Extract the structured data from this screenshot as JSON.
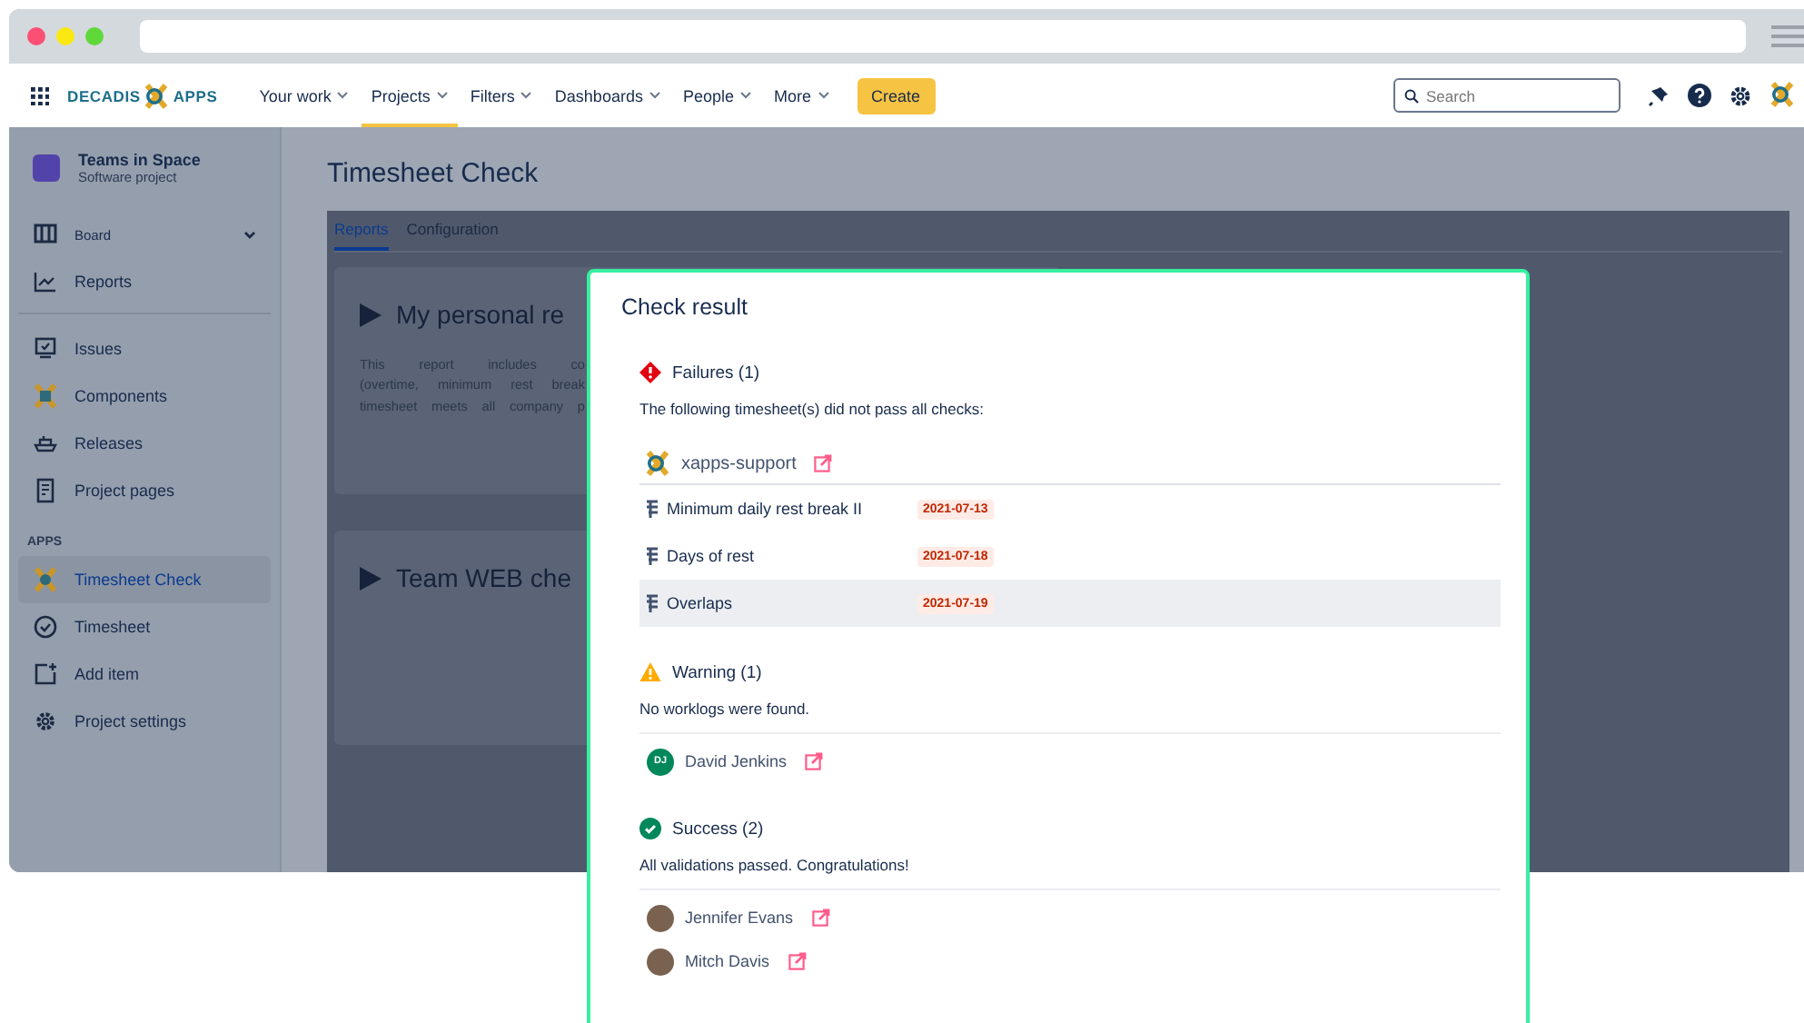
{
  "nav": {
    "logo": {
      "left": "DECADIS",
      "right": "APPS"
    },
    "items": [
      {
        "label": "Your work",
        "selected": false
      },
      {
        "label": "Projects",
        "selected": true
      },
      {
        "label": "Filters",
        "selected": false
      },
      {
        "label": "Dashboards",
        "selected": false
      },
      {
        "label": "People",
        "selected": false
      },
      {
        "label": "More",
        "selected": false
      }
    ],
    "create": "Create",
    "search": {
      "placeholder": "Search"
    }
  },
  "sidebar": {
    "project": {
      "name": "Teams in Space",
      "type": "Software project"
    },
    "groups": [
      {
        "items": [
          {
            "label": "Board",
            "kind": "dropdown",
            "selected": false
          },
          {
            "label": "Reports",
            "kind": "link",
            "selected": false
          }
        ]
      },
      {
        "items": [
          {
            "label": "Issues",
            "kind": "link",
            "selected": false
          },
          {
            "label": "Components",
            "kind": "link",
            "selected": false
          },
          {
            "label": "Releases",
            "kind": "link",
            "selected": false
          },
          {
            "label": "Project pages",
            "kind": "link",
            "selected": false
          }
        ]
      },
      {
        "heading": "APPS",
        "items": [
          {
            "label": "Timesheet Check",
            "kind": "link",
            "selected": true
          },
          {
            "label": "Timesheet",
            "kind": "link",
            "selected": false
          },
          {
            "label": "Add item",
            "kind": "link",
            "selected": false
          },
          {
            "label": "Project settings",
            "kind": "link",
            "selected": false
          }
        ]
      }
    ]
  },
  "page": {
    "title": "Timesheet Check",
    "tabs": [
      {
        "label": "Reports",
        "selected": true
      },
      {
        "label": "Configuration",
        "selected": false
      }
    ],
    "cards": [
      {
        "title": "My personal re",
        "description": [
          "This report includes co",
          "(overtime, minimum rest break",
          "timesheet meets all company p"
        ]
      },
      {
        "title": "Team WEB che"
      }
    ]
  },
  "modal": {
    "title": "Check result",
    "sections": [
      {
        "kind": "failure",
        "heading": "Failures (1)",
        "description": "The following timesheet(s) did not pass all checks:",
        "groups": [
          {
            "name": "xapps-support",
            "rows": [
              {
                "name": "Minimum daily rest break II",
                "date": "2021-07-13",
                "highlighted": false
              },
              {
                "name": "Days of rest",
                "date": "2021-07-18",
                "highlighted": false
              },
              {
                "name": "Overlaps",
                "date": "2021-07-19",
                "highlighted": true
              }
            ]
          }
        ]
      },
      {
        "kind": "warning",
        "heading": "Warning (1)",
        "description": "No worklogs were found.",
        "users": [
          {
            "name": "David Jenkins",
            "kind": "initials",
            "initials": "DJ"
          }
        ]
      },
      {
        "kind": "success",
        "heading": "Success (2)",
        "description": "All validations passed. Congratulations!",
        "users": [
          {
            "name": "Jennifer Evans",
            "kind": "photo"
          },
          {
            "name": "Mitch Davis",
            "kind": "photo"
          }
        ]
      }
    ]
  }
}
